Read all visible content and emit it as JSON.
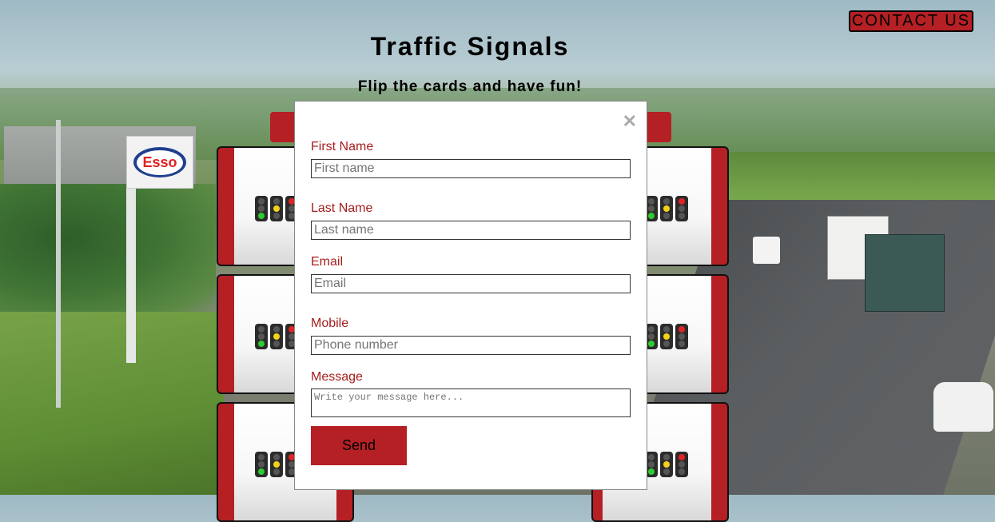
{
  "header": {
    "title": "Traffic Signals",
    "subtitle": "Flip the cards and have fun!",
    "contact_label": "CONTACT US"
  },
  "modal": {
    "close_icon": "close-icon",
    "fields": {
      "first_name": {
        "label": "First Name",
        "placeholder": "First name"
      },
      "last_name": {
        "label": "Last Name",
        "placeholder": "Last name"
      },
      "email": {
        "label": "Email",
        "placeholder": "Email"
      },
      "mobile": {
        "label": "Mobile",
        "placeholder": "Phone number"
      },
      "message": {
        "label": "Message",
        "placeholder": "Write your message here..."
      }
    },
    "send_label": "Send"
  },
  "background": {
    "sign_text": "Esso"
  },
  "colors": {
    "accent": "#b52024",
    "label": "#a51d1d",
    "card_face": "#ffffff"
  },
  "cards": {
    "icon": "traffic-light-icon"
  }
}
